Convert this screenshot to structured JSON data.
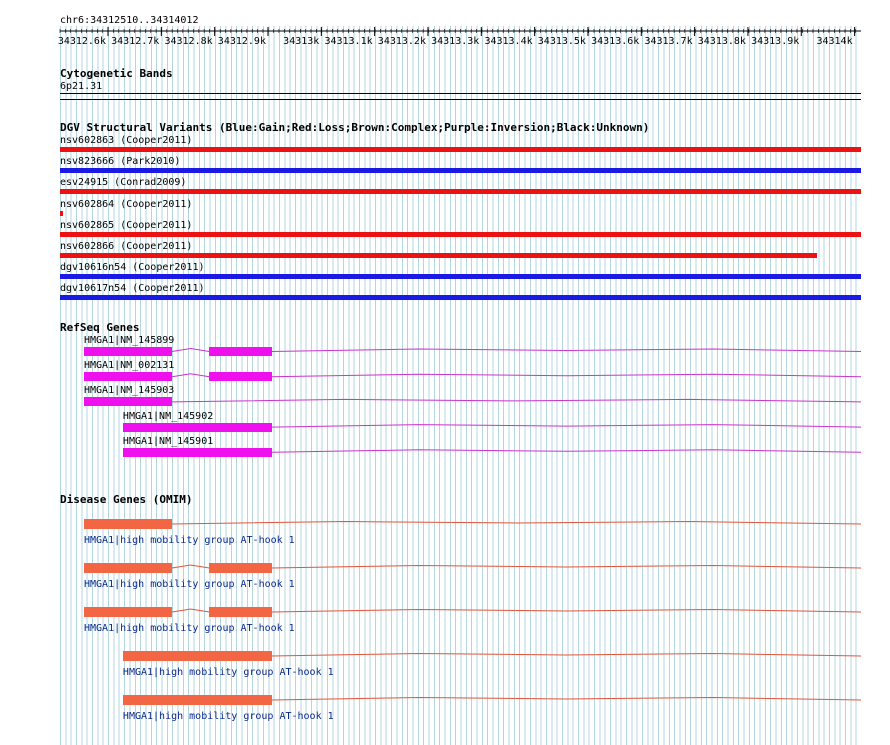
{
  "position": "chr6:34312510..34314012",
  "ruler": {
    "start": 34312510,
    "end": 34314012,
    "ticks": [
      "34312.6k",
      "34312.7k",
      "34312.8k",
      "34312.9k",
      "34313k",
      "34313.1k",
      "34313.2k",
      "34313.3k",
      "34313.4k",
      "34313.5k",
      "34313.6k",
      "34313.7k",
      "34313.8k",
      "34313.9k",
      "34314k"
    ]
  },
  "cytoband": {
    "title": "Cytogenetic Bands",
    "band": "6p21.31"
  },
  "dgv": {
    "title": "DGV Structural Variants (Blue:Gain;Red:Loss;Brown:Complex;Purple:Inversion;Black:Unknown)",
    "colors": {
      "gain": "#1a1ae6",
      "loss": "#ee1111"
    },
    "items": [
      {
        "label": "nsv602863 (Cooper2011)",
        "type": "loss",
        "start": 34312510,
        "end": 34314012
      },
      {
        "label": "nsv823666 (Park2010)",
        "type": "gain",
        "start": 34312510,
        "end": 34314012
      },
      {
        "label": "esv24915 (Conrad2009)",
        "type": "loss",
        "start": 34312510,
        "end": 34314012
      },
      {
        "label": "nsv602864 (Cooper2011)",
        "type": "loss",
        "start": 34312510,
        "end": 34312515
      },
      {
        "label": "nsv602865 (Cooper2011)",
        "type": "loss",
        "start": 34312510,
        "end": 34314012
      },
      {
        "label": "nsv602866 (Cooper2011)",
        "type": "loss",
        "start": 34312510,
        "end": 34313930
      },
      {
        "label": "dgv10616n54 (Cooper2011)",
        "type": "gain",
        "start": 34312510,
        "end": 34314012
      },
      {
        "label": "dgv10617n54 (Cooper2011)",
        "type": "gain",
        "start": 34312510,
        "end": 34314012
      }
    ]
  },
  "refseq": {
    "title": "RefSeq Genes",
    "color": "#ee11ee",
    "line_color": "#cc33cc",
    "genes": [
      {
        "label": "HMGA1|NM_145899",
        "start": 34312555,
        "exons": [
          [
            34312555,
            34312720
          ],
          [
            34312790,
            34312907
          ]
        ]
      },
      {
        "label": "HMGA1|NM_002131",
        "start": 34312555,
        "exons": [
          [
            34312555,
            34312720
          ],
          [
            34312790,
            34312907
          ]
        ]
      },
      {
        "label": "HMGA1|NM_145903",
        "start": 34312555,
        "exons": [
          [
            34312555,
            34312720
          ]
        ]
      },
      {
        "label": "HMGA1|NM_145902",
        "start": 34312628,
        "exons": [
          [
            34312628,
            34312907
          ]
        ]
      },
      {
        "label": "HMGA1|NM_145901",
        "start": 34312628,
        "exons": [
          [
            34312628,
            34312907
          ]
        ]
      }
    ]
  },
  "omim": {
    "title": "Disease Genes (OMIM)",
    "color": "#f26644",
    "line_color": "#e0553a",
    "genes": [
      {
        "label": "HMGA1|high mobility group AT-hook 1",
        "start": 34312555,
        "exons": [
          [
            34312555,
            34312720
          ]
        ]
      },
      {
        "label": "HMGA1|high mobility group AT-hook 1",
        "start": 34312555,
        "exons": [
          [
            34312555,
            34312720
          ],
          [
            34312790,
            34312907
          ]
        ]
      },
      {
        "label": "HMGA1|high mobility group AT-hook 1",
        "start": 34312555,
        "exons": [
          [
            34312555,
            34312720
          ],
          [
            34312790,
            34312907
          ]
        ]
      },
      {
        "label": "HMGA1|high mobility group AT-hook 1",
        "start": 34312628,
        "exons": [
          [
            34312628,
            34312907
          ]
        ]
      },
      {
        "label": "HMGA1|high mobility group AT-hook 1",
        "start": 34312628,
        "exons": [
          [
            34312628,
            34312907
          ]
        ]
      }
    ]
  }
}
